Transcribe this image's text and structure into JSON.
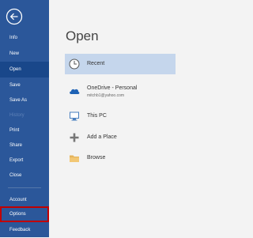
{
  "sidebar": {
    "items": [
      {
        "label": "Info"
      },
      {
        "label": "New"
      },
      {
        "label": "Open"
      },
      {
        "label": "Save"
      },
      {
        "label": "Save As"
      },
      {
        "label": "History"
      },
      {
        "label": "Print"
      },
      {
        "label": "Share"
      },
      {
        "label": "Export"
      },
      {
        "label": "Close"
      },
      {
        "label": "Account"
      },
      {
        "label": "Options"
      },
      {
        "label": "Feedback"
      }
    ]
  },
  "main": {
    "title": "Open",
    "locations": [
      {
        "label": "Recent",
        "icon": "clock-icon"
      },
      {
        "label": "OneDrive - Personal",
        "sublabel": "mitchb1@yahoo.com",
        "icon": "cloud-icon"
      },
      {
        "label": "This PC",
        "icon": "computer-icon"
      },
      {
        "label": "Add a Place",
        "icon": "plus-icon"
      },
      {
        "label": "Browse",
        "icon": "folder-icon"
      }
    ]
  },
  "colors": {
    "sidebar": "#2b579a",
    "selected_nav": "#19478a",
    "highlight_box": "#c00000",
    "selected_location": "#c5d6ec"
  }
}
